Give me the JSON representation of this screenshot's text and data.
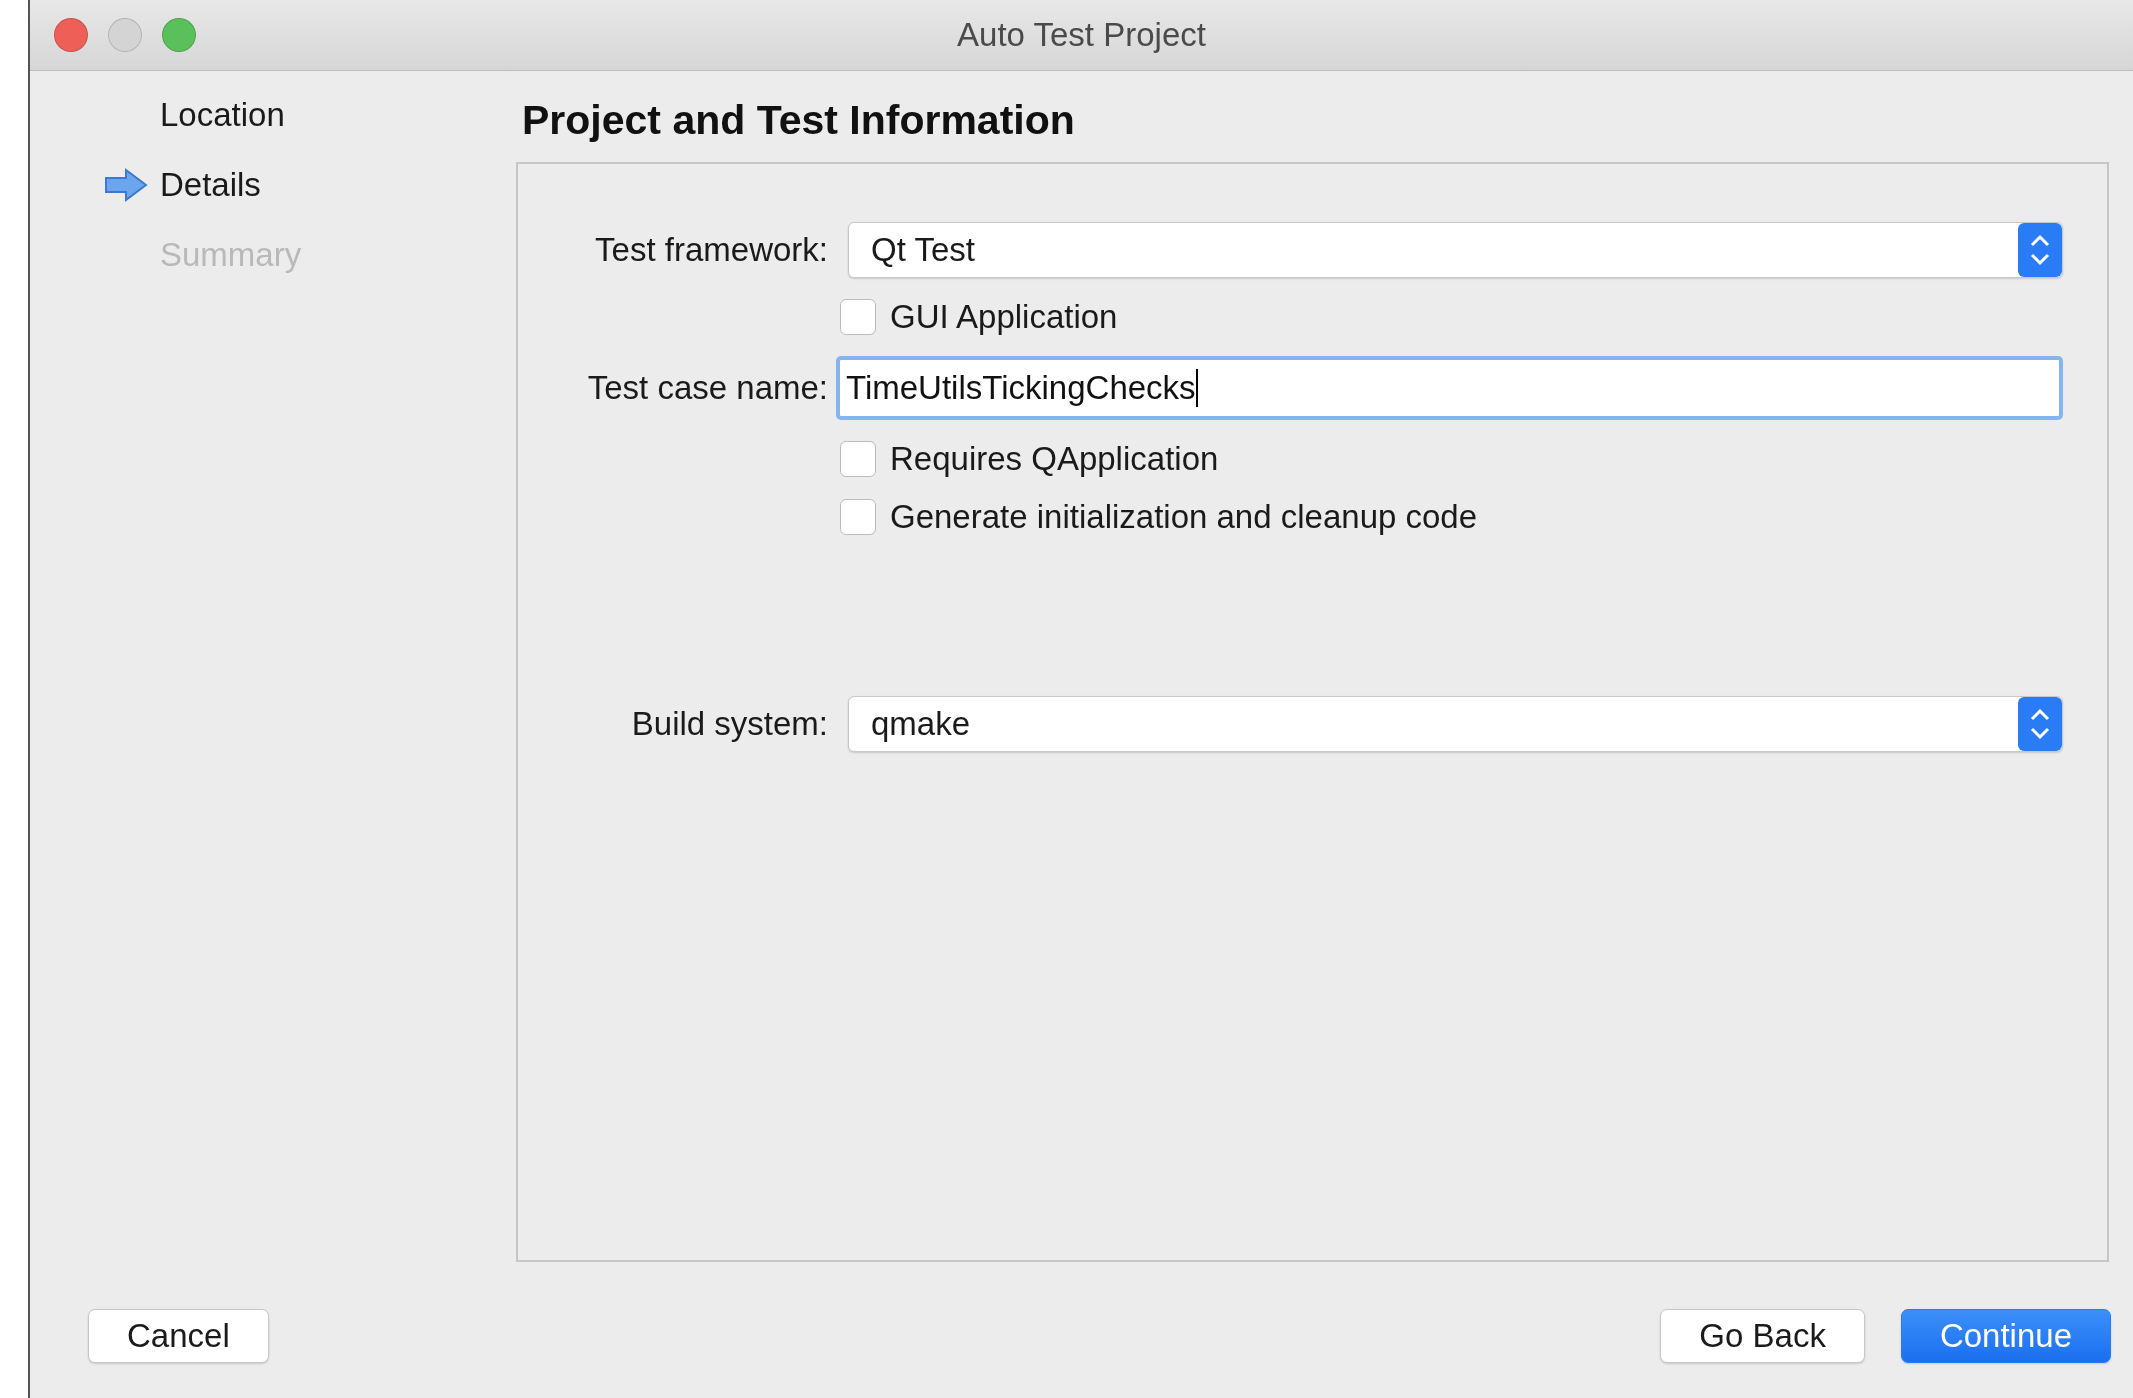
{
  "window": {
    "title": "Auto Test Project"
  },
  "steps": [
    {
      "label": "Location",
      "selected": false,
      "disabled": false
    },
    {
      "label": "Details",
      "selected": true,
      "disabled": false
    },
    {
      "label": "Summary",
      "selected": false,
      "disabled": true
    }
  ],
  "heading": "Project and Test Information",
  "form": [
    {
      "kind": "combo",
      "label": "Test framework:",
      "value": "Qt Test"
    },
    {
      "kind": "checkbox",
      "label": "GUI Application",
      "checked": false
    },
    {
      "kind": "text",
      "label": "Test case name:",
      "value": "TimeUtilsTickingChecks",
      "focused": true
    },
    {
      "kind": "checkbox",
      "label": "Requires QApplication",
      "checked": false
    },
    {
      "kind": "checkbox",
      "label": "Generate initialization and cleanup code",
      "checked": false
    },
    {
      "kind": "spacer"
    },
    {
      "kind": "combo",
      "label": "Build system:",
      "value": "qmake"
    }
  ],
  "buttons": [
    {
      "label": "Cancel",
      "primary": false
    },
    {
      "label": "Go Back",
      "primary": false
    },
    {
      "label": "Continue",
      "primary": true
    }
  ]
}
